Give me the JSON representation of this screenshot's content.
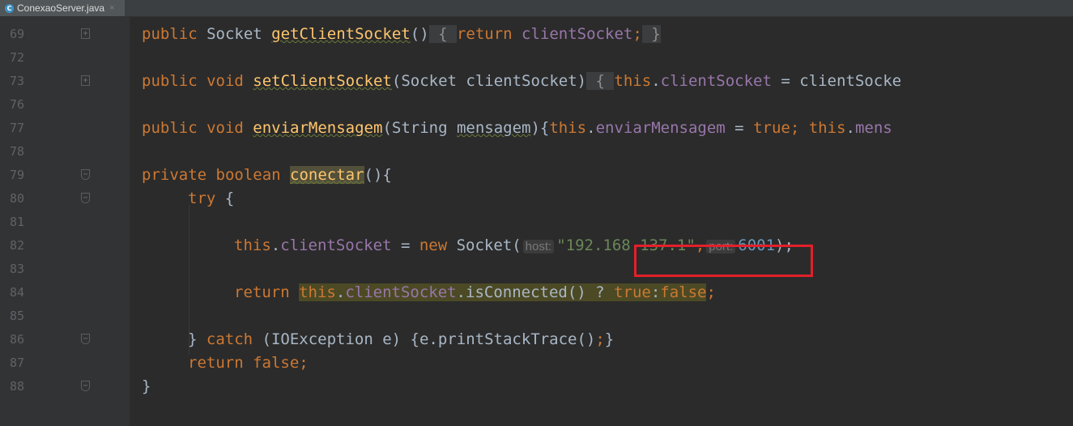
{
  "tab": {
    "icon": "class-c-icon",
    "filename": "ConexaoServer.java",
    "close_glyph": "×"
  },
  "lines": [
    {
      "no": "69",
      "fold": "plus"
    },
    {
      "no": "72",
      "fold": ""
    },
    {
      "no": "73",
      "fold": "plus"
    },
    {
      "no": "76",
      "fold": ""
    },
    {
      "no": "77",
      "fold": ""
    },
    {
      "no": "78",
      "fold": ""
    },
    {
      "no": "79",
      "fold": "shield"
    },
    {
      "no": "80",
      "fold": "shield"
    },
    {
      "no": "81",
      "fold": ""
    },
    {
      "no": "82",
      "fold": ""
    },
    {
      "no": "83",
      "fold": ""
    },
    {
      "no": "84",
      "fold": ""
    },
    {
      "no": "85",
      "fold": ""
    },
    {
      "no": "86",
      "fold": "shield"
    },
    {
      "no": "87",
      "fold": ""
    },
    {
      "no": "88",
      "fold": "shield"
    }
  ],
  "code": {
    "l69": {
      "kw_public": "public",
      "type": " Socket ",
      "method": "getClientSocket",
      "parens": "()",
      "fold_open": " { ",
      "kw_return": "return",
      "field": " clientSocket",
      "semi": ";",
      "fold_close": " }"
    },
    "l73": {
      "kw_public": "public",
      "kw_void": " void ",
      "method": "setClientSocket",
      "params": "(Socket clientSocket)",
      "fold_open": " { ",
      "kw_this": "this",
      "dot": ".",
      "field": "clientSocket",
      "assign": " = clientSocke"
    },
    "l77": {
      "kw_public": "public",
      "kw_void": " void ",
      "method": "enviarMensagem",
      "params_a": "(String ",
      "param": "mensagem",
      "params_b": "){",
      "kw_this": "this",
      "dot": ".",
      "field": "enviarMensagem",
      "assign": " = ",
      "kw_true": "true",
      "semi": ";",
      "kw_this2": " this",
      "dot2": ".",
      "field2": "mens"
    },
    "l79": {
      "kw_private": "private",
      "kw_boolean": " boolean ",
      "method": "conectar",
      "rest": "(){"
    },
    "l80": {
      "kw_try": "try",
      "rest": " {"
    },
    "l82": {
      "kw_this": "this",
      "dot": ".",
      "field": "clientSocket",
      "assign": " = ",
      "kw_new": "new",
      "ctor": " Socket(",
      "hint_host": "host:",
      "str": "\"192.168.137.1\"",
      "comma": ",",
      "hint_port": "port:",
      "num": "6001",
      "close": ");"
    },
    "l84": {
      "kw_return": "return",
      "sp": " ",
      "kw_this": "this",
      "dot": ".",
      "field": "clientSocket",
      "call": ".isConnected() ? ",
      "kw_true": "true",
      "colon": ":",
      "kw_false": "false",
      "semi": ";"
    },
    "l86": {
      "brace": "} ",
      "kw_catch": "catch",
      "rest": " (IOException e) {e.printStackTrace()",
      "semi": ";",
      "end": "}"
    },
    "l87": {
      "kw_return": "return",
      "kw_false": " false",
      "semi": ";"
    },
    "l88": {
      "brace": "}"
    }
  },
  "highlight": {
    "box_color": "#e3202a"
  }
}
